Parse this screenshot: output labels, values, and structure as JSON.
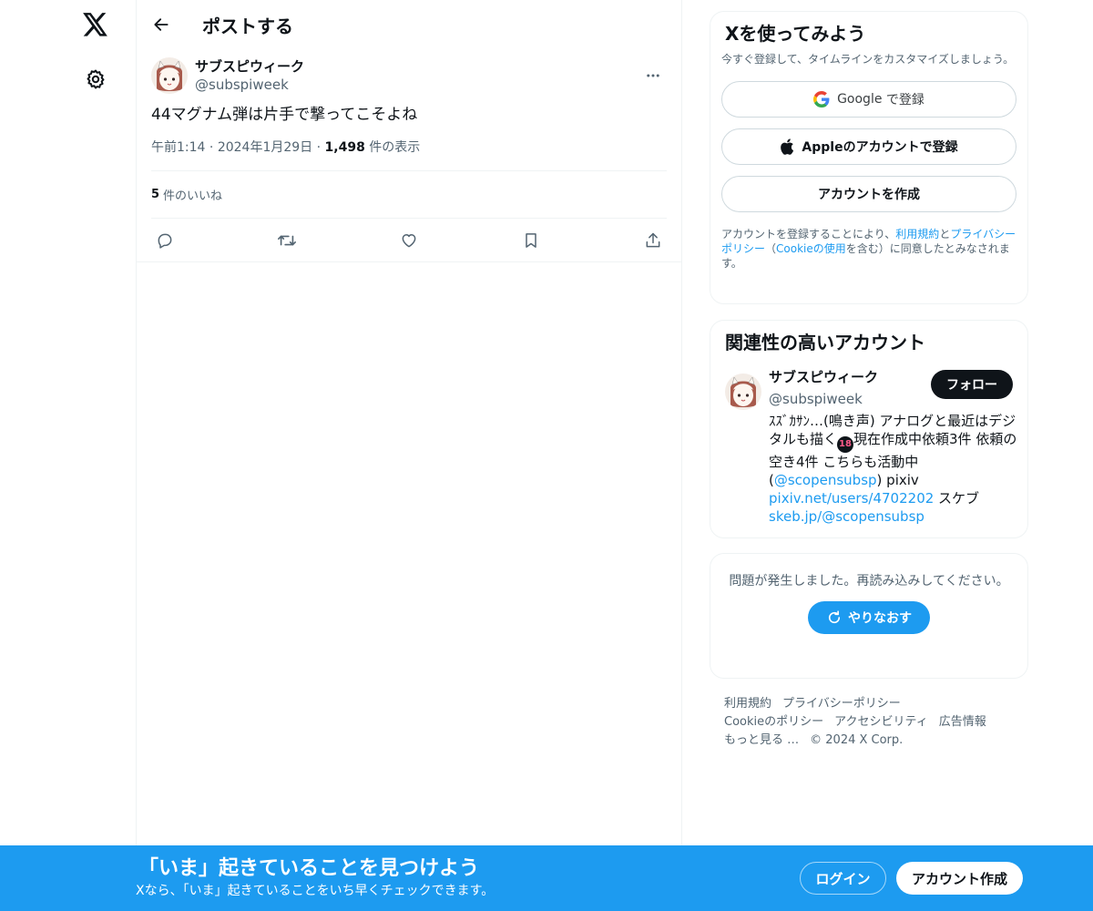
{
  "nav": {
    "logo_icon": "x-logo-icon",
    "settings_icon": "gear-icon"
  },
  "header": {
    "title": "ポストする"
  },
  "post": {
    "author_name": "サブスピウィーク",
    "author_handle": "@subspiweek",
    "text": "44マグナム弾は片手で撃ってこそよね",
    "time": "午前1:14",
    "date": "2024年1月29日",
    "views_count": "1,498",
    "views_label": "件の表示",
    "likes_count": "5",
    "likes_label": "件のいいね",
    "actions": [
      "reply-icon",
      "repost-icon",
      "like-icon",
      "bookmark-icon",
      "share-icon"
    ]
  },
  "signup": {
    "title": "Xを使ってみよう",
    "description": "今すぐ登録して、タイムラインをカスタマイズしましょう。",
    "google_brand": "Google",
    "google_suffix": "で登録",
    "apple_label": "Appleのアカウントで登録",
    "create_label": "アカウントを作成",
    "terms_prefix": "アカウントを登録することにより、",
    "terms_link": "利用規約",
    "terms_and": "と",
    "privacy_link": "プライバシーポリシー",
    "terms_paren_open": "（",
    "cookie_link": "Cookieの使用",
    "terms_paren_close": "を含む）に同意したとみなされます。"
  },
  "related": {
    "title": "関連性の高いアカウント",
    "user_name": "サブスピウィーク",
    "user_handle": "@subspiweek",
    "follow_label": "フォロー",
    "bio_part1": "ｽｽﾞｶｻﾝ…(鳴き声) アナログと最近はデジタルも描く",
    "bio_badge": "18",
    "bio_part2": "現在作成中依頼3件 依頼の空き4件 こちらも活動中(",
    "bio_mention": "@scopensubsp",
    "bio_part3": ") pixiv ",
    "bio_link1": "pixiv.net/users/4702202",
    "bio_part4": " スケブ ",
    "bio_link2": "skeb.jp/@scopensubsp"
  },
  "error": {
    "message": "問題が発生しました。再読み込みしてください。",
    "retry_label": "やりなおす"
  },
  "footer": {
    "links": [
      "利用規約",
      "プライバシーポリシー",
      "Cookieのポリシー",
      "アクセシビリティ",
      "広告情報",
      "もっと見る …",
      "© 2024 X Corp."
    ]
  },
  "banner": {
    "title": "「いま」起きていることを見つけよう",
    "subtitle": "Xなら、「いま」起きていることをいち早くチェックできます。",
    "login_label": "ログイン",
    "create_label": "アカウント作成"
  },
  "colors": {
    "accent": "#1d9bf0",
    "text_primary": "#0f1419",
    "text_secondary": "#536471",
    "border": "#eff3f4"
  }
}
